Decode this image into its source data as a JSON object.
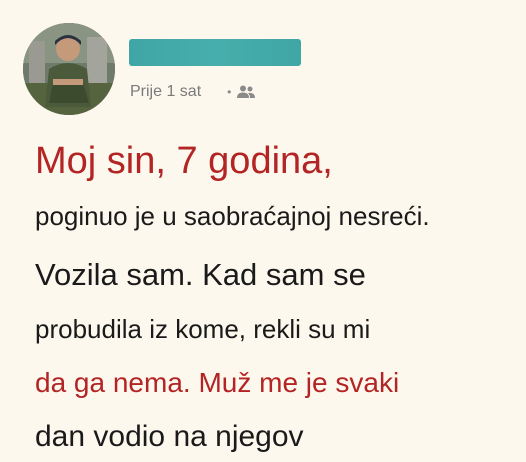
{
  "post": {
    "time_label": "Prije 1 sat",
    "dot": "•",
    "audience_icon": "friends-icon",
    "lines": [
      "Moj sin, 7 godina,",
      "poginuo je u saobraćajnoj nesreći.",
      "Vozila sam. Kad sam se",
      "probudila iz kome, rekli su mi",
      "da ga nema. Muž me je svaki",
      "dan vodio na njegov"
    ]
  },
  "colors": {
    "background": "#fdf8ee",
    "accent_red": "#b32424",
    "name_redaction": "#3fa6a5",
    "text": "#1a1a1a",
    "meta": "#7a7a7a"
  }
}
